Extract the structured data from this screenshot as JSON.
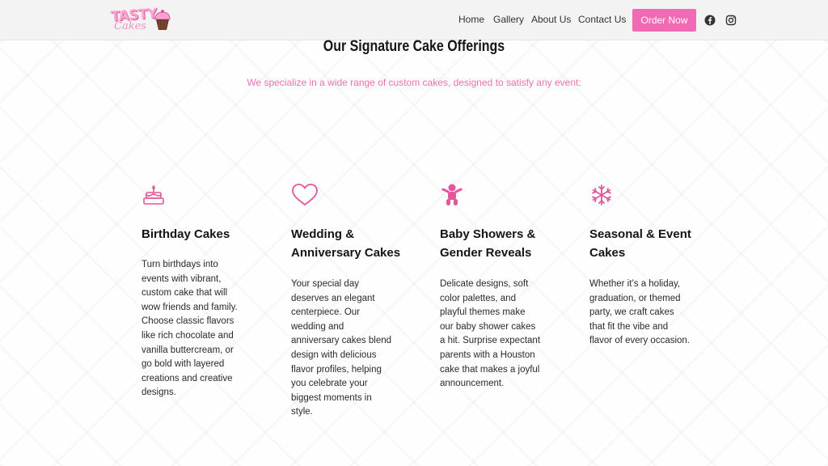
{
  "brand": {
    "logo_text_top": "TASTY",
    "logo_text_bottom": "Cakes",
    "accent_color": "#f16bb4"
  },
  "nav": {
    "links": [
      "Home",
      "Gallery",
      "About Us",
      "Contact Us"
    ],
    "cta": "Order Now",
    "social_icons": [
      "facebook-icon",
      "instagram-icon"
    ]
  },
  "section": {
    "title": "Our Signature Cake Offerings",
    "subtitle": "We specialize in a wide range of custom cakes, designed to satisfy any event:"
  },
  "cards": [
    {
      "icon": "birthday-cake-icon",
      "title": "Birthday Cakes",
      "description": "Turn birthdays into events with vibrant, custom cake that will wow friends and family. Choose classic flavors like rich chocolate and vanilla buttercream, or go bold with layered creations and creative designs."
    },
    {
      "icon": "heart-icon",
      "title": "Wedding & Anniversary Cakes",
      "description": "Your special day deserves an elegant centerpiece. Our wedding and anniversary cakes blend design with delicious flavor profiles, helping you celebrate your biggest moments in style."
    },
    {
      "icon": "baby-icon",
      "title": "Baby Showers & Gender Reveals",
      "description": "Delicate designs, soft color palettes, and playful themes make our baby shower cakes a hit. Surprise expectant parents with a Houston cake that makes a joyful announcement."
    },
    {
      "icon": "snowflake-icon",
      "title": "Seasonal & Event Cakes",
      "description": "Whether it’s a holiday, graduation, or themed party, we craft cakes that fit the vibe and flavor of every occasion."
    }
  ]
}
